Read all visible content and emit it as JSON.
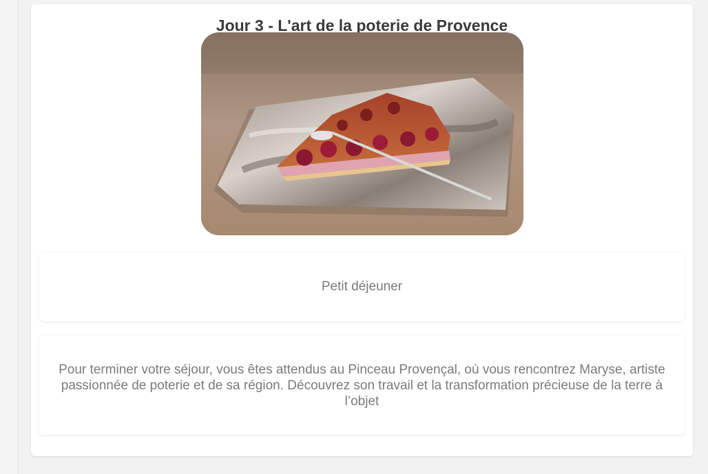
{
  "day": {
    "title": "Jour 3 - L'art de la poterie de Provence",
    "image_icon": "cherry-clafoutis-photo",
    "meal": "Petit déjeuner",
    "description": "Pour terminer votre séjour, vous êtes attendus au Pinceau Provençal, où vous rencontrez Maryse, artiste passionnée de poterie et de sa région. Découvrez son travail et la transformation précieuse de la terre à l’objet"
  }
}
